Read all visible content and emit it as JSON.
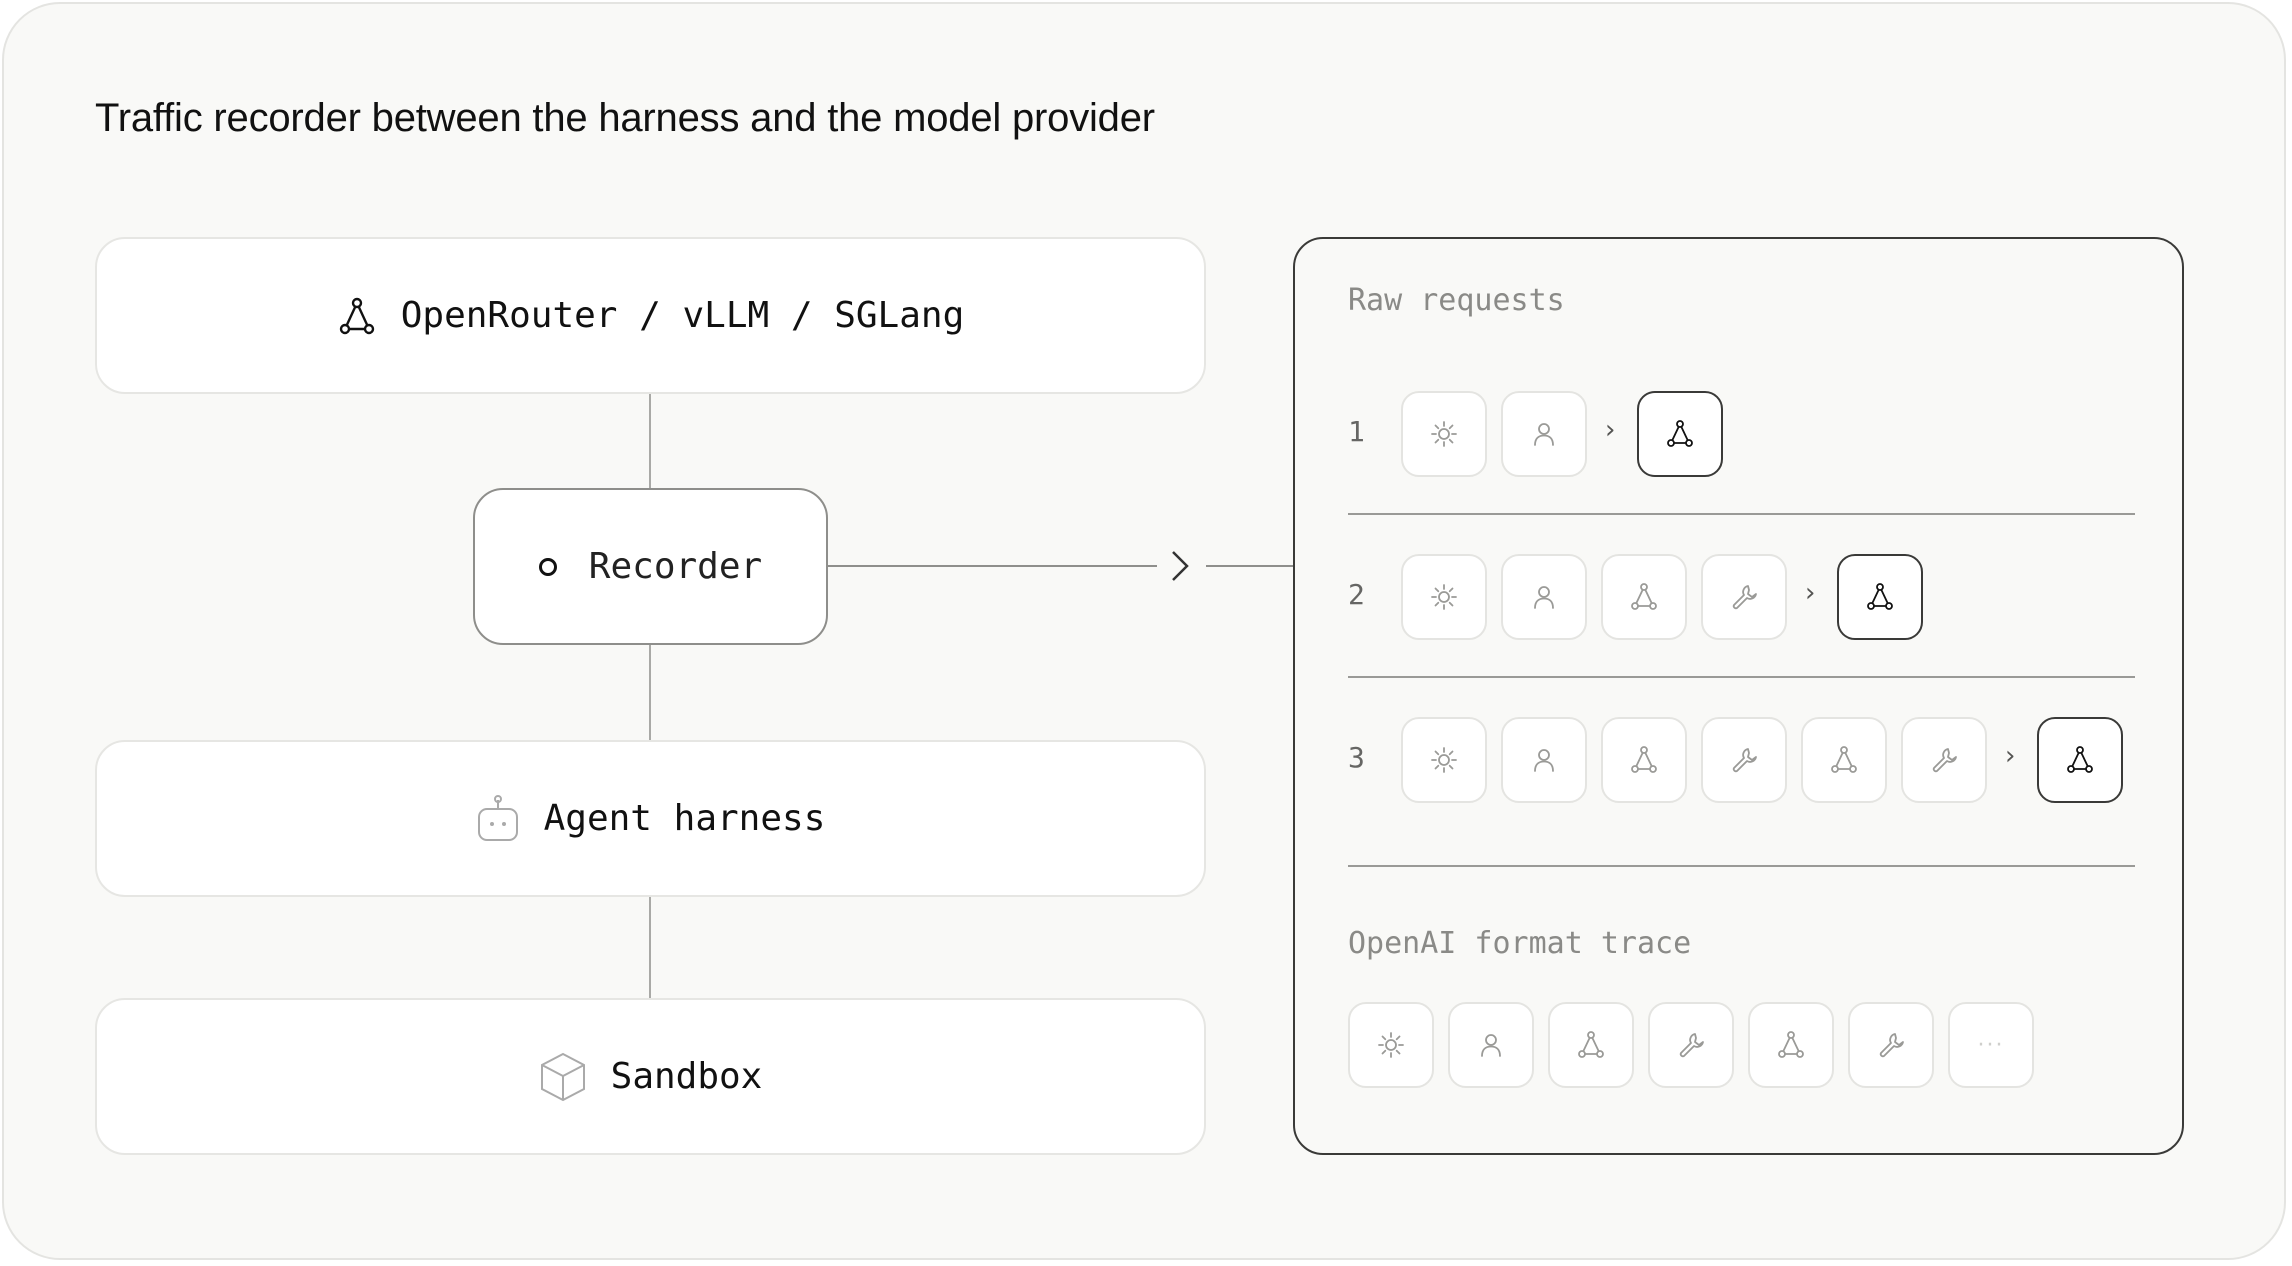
{
  "title": "Traffic recorder between the harness and the model provider",
  "stack": {
    "provider": {
      "label": "OpenRouter / vLLM / SGLang",
      "icon": "network-icon"
    },
    "recorder": {
      "label": "Recorder",
      "icon": "circle-icon"
    },
    "harness": {
      "label": "Agent harness",
      "icon": "robot-icon"
    },
    "sandbox": {
      "label": "Sandbox",
      "icon": "cube-icon"
    }
  },
  "panel": {
    "raw_label": "Raw requests",
    "rows": [
      {
        "num": "1",
        "chips": [
          "sun-icon",
          "user-icon"
        ],
        "response": "network-icon"
      },
      {
        "num": "2",
        "chips": [
          "sun-icon",
          "user-icon",
          "network-icon",
          "wrench-icon"
        ],
        "response": "network-icon"
      },
      {
        "num": "3",
        "chips": [
          "sun-icon",
          "user-icon",
          "network-icon",
          "wrench-icon",
          "network-icon",
          "wrench-icon"
        ],
        "response": "network-icon"
      }
    ],
    "caret": "›",
    "trace_label": "OpenAI format trace",
    "trace_chips": [
      "sun-icon",
      "user-icon",
      "network-icon",
      "wrench-icon",
      "network-icon",
      "wrench-icon",
      "ellipsis-icon"
    ]
  },
  "colors": {
    "background": "#f9f9f7",
    "card": "#ffffff",
    "text": "#111111",
    "muted_text": "#8a8a87",
    "light_icon": "#9a9a97",
    "dark_icon": "#111111"
  }
}
